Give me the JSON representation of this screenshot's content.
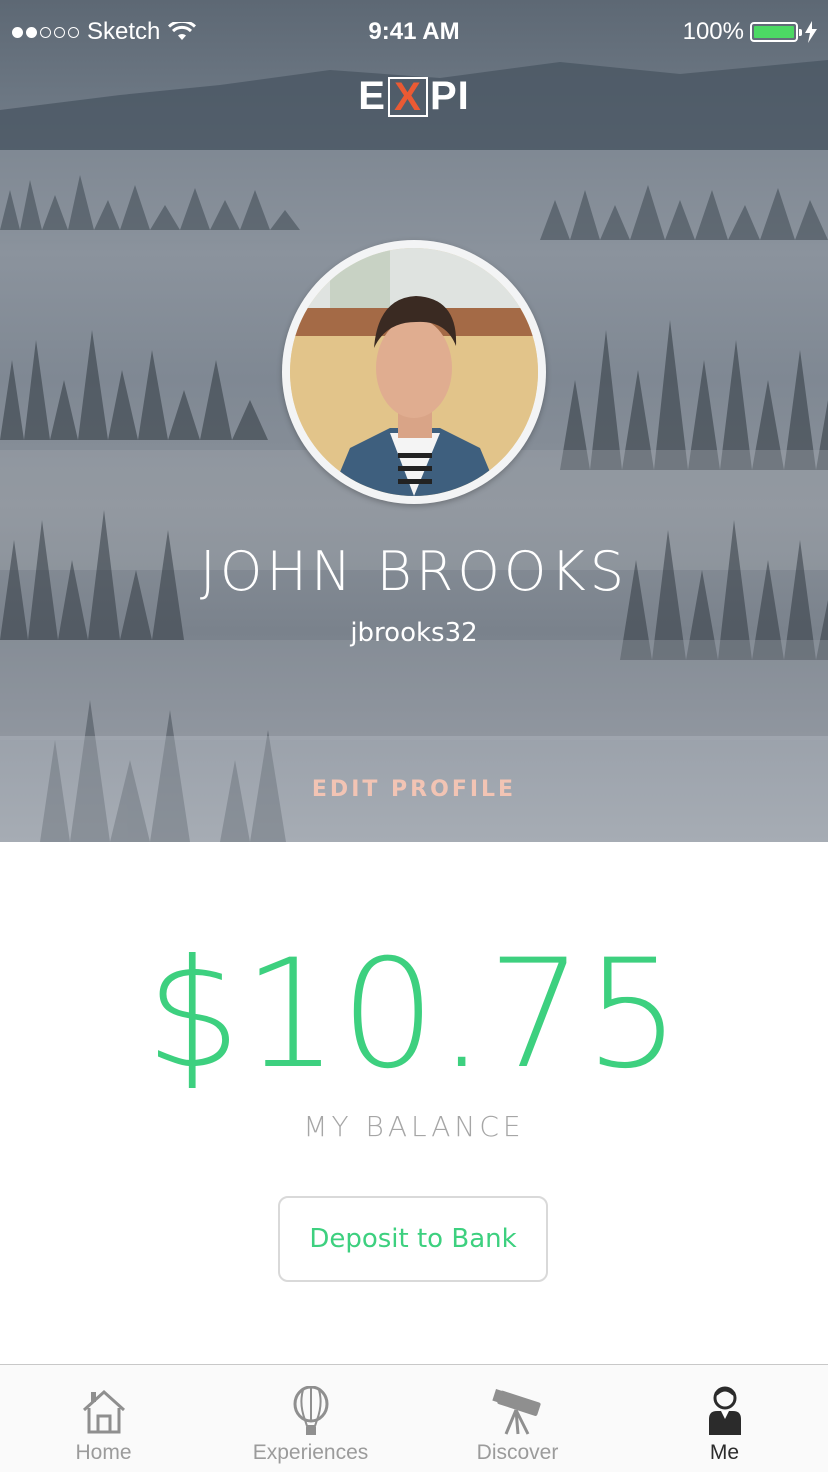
{
  "status_bar": {
    "carrier": "Sketch",
    "time": "9:41 AM",
    "battery": "100%"
  },
  "app": {
    "logo_left": "E",
    "logo_mid": "X",
    "logo_right": "PI"
  },
  "profile": {
    "name": "JOHN BROOKS",
    "username": "jbrooks32",
    "edit_label": "EDIT PROFILE"
  },
  "balance": {
    "amount": "$10.75",
    "label": "MY BALANCE",
    "deposit_label": "Deposit to Bank"
  },
  "tabs": [
    {
      "label": "Home",
      "icon": "home-icon"
    },
    {
      "label": "Experiences",
      "icon": "balloon-icon"
    },
    {
      "label": "Discover",
      "icon": "telescope-icon"
    },
    {
      "label": "Me",
      "icon": "user-icon"
    }
  ],
  "colors": {
    "accent_green": "#3dd07f",
    "logo_orange": "#ea5a33",
    "edit_profile": "#f2c4b4",
    "battery_green": "#4cd964"
  }
}
